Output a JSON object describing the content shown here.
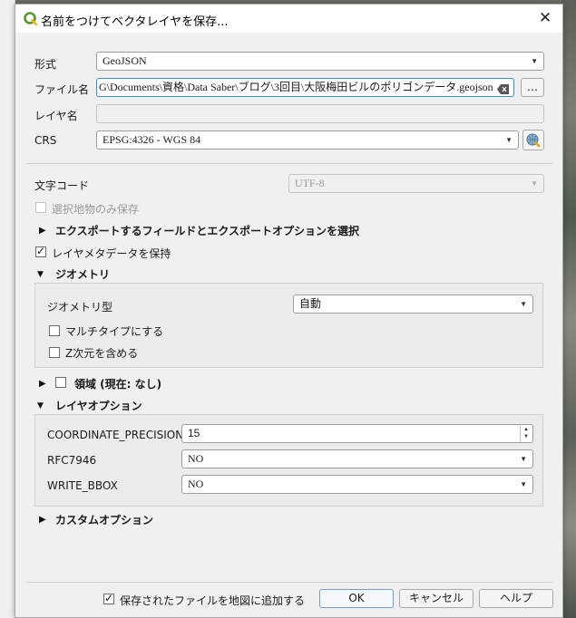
{
  "window": {
    "title": "名前をつけてベクタレイヤを保存...",
    "close_icon": "close-icon",
    "app_icon": "qgis-icon"
  },
  "form": {
    "format_label": "形式",
    "format_value": "GeoJSON",
    "filename_label": "ファイル名",
    "filename_value": "G\\Documents\\資格\\Data Saber\\ブログ\\3回目\\大阪梅田ビルのポリゴンデータ.geojson",
    "browse_label": "…",
    "layername_label": "レイヤ名",
    "layername_value": "",
    "crs_label": "CRS",
    "crs_value": "EPSG:4326 - WGS 84",
    "encoding_label": "文字コード",
    "encoding_value": "UTF-8",
    "selected_only_label": "選択地物のみ保存",
    "selected_only_checked": false,
    "export_fields_label": "エクスポートするフィールドとエクスポートオプションを選択",
    "keep_metadata_label": "レイヤメタデータを保持",
    "keep_metadata_checked": true
  },
  "geometry": {
    "section_label": "ジオメトリ",
    "type_label": "ジオメトリ型",
    "type_value": "自動",
    "multitype_label": "マルチタイプにする",
    "multitype_checked": false,
    "z_label": "Z次元を含める",
    "z_checked": false
  },
  "extent": {
    "section_label": "領域 (現在: なし)",
    "checked": false
  },
  "layer_options": {
    "section_label": "レイヤオプション",
    "rows": [
      {
        "label": "COORDINATE_PRECISION",
        "value": "15"
      },
      {
        "label": "RFC7946",
        "value": "NO"
      },
      {
        "label": "WRITE_BBOX",
        "value": "NO"
      }
    ]
  },
  "custom_options": {
    "section_label": "カスタムオプション"
  },
  "footer": {
    "add_to_map_label": "保存されたファイルを地図に追加する",
    "add_to_map_checked": true,
    "ok_label": "OK",
    "cancel_label": "キャンセル",
    "help_label": "ヘルプ"
  }
}
